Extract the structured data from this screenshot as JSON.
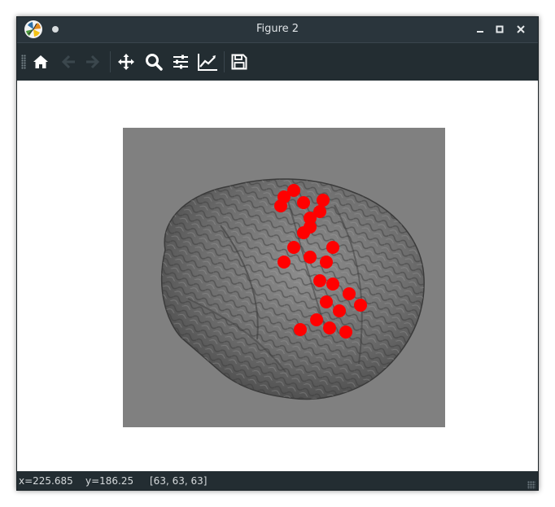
{
  "window": {
    "title": "Figure 2"
  },
  "toolbar": {
    "buttons": [
      {
        "name": "home-icon",
        "enabled": true
      },
      {
        "name": "back-arrow-icon",
        "enabled": false
      },
      {
        "name": "forward-arrow-icon",
        "enabled": false
      },
      {
        "name": "pan-move-icon",
        "enabled": true
      },
      {
        "name": "zoom-magnifier-icon",
        "enabled": true
      },
      {
        "name": "configure-subplots-icon",
        "enabled": true
      },
      {
        "name": "edit-axis-icon",
        "enabled": true
      },
      {
        "name": "save-disk-icon",
        "enabled": true
      }
    ]
  },
  "status": {
    "x": "x=225.685",
    "y": "y=186.25",
    "pixel": "[63, 63, 63]"
  },
  "colors": {
    "titlebar": "#2a353c",
    "toolbar": "#232d32",
    "plot_background": "#808080",
    "marker": "#ff0000"
  },
  "figure": {
    "content": "3D brain surface render with electrode markers",
    "electrode_count": 24
  }
}
